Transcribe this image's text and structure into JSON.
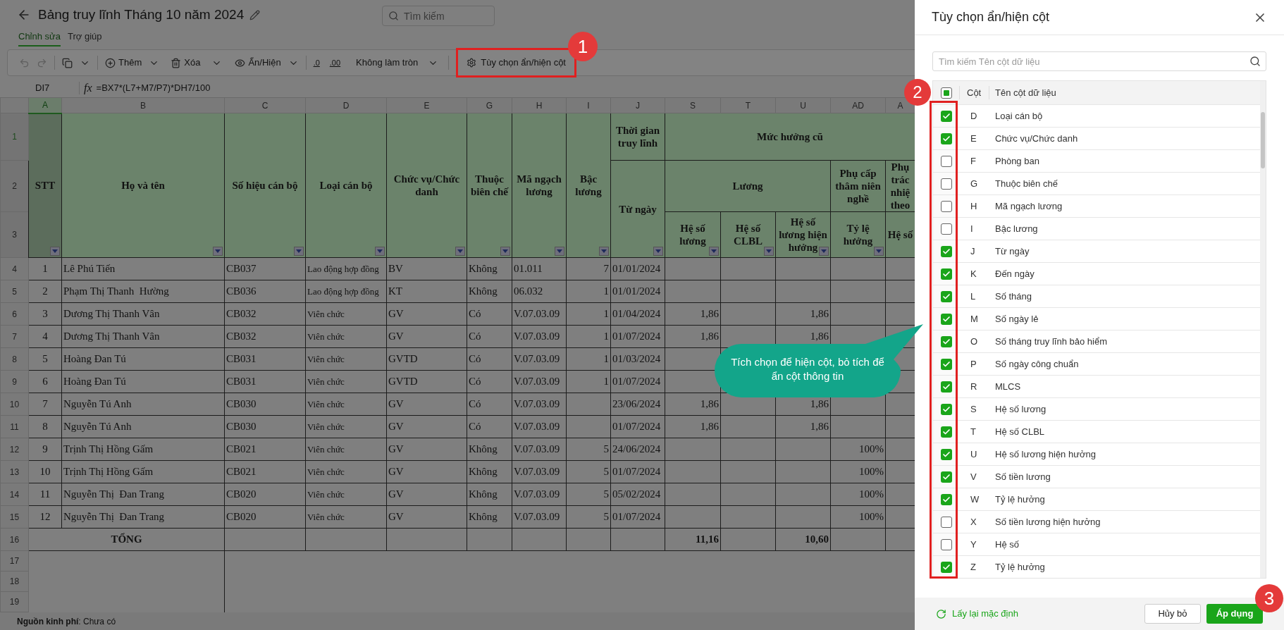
{
  "header": {
    "title": "Bảng truy lĩnh Tháng 10 năm 2024",
    "search": {
      "placeholder": "Tìm kiếm"
    }
  },
  "tabs": [
    {
      "label": "Chỉnh sửa",
      "selected": true
    },
    {
      "label": "Trợ giúp",
      "selected": false
    }
  ],
  "toolbar": {
    "undo": {
      "disabled": true
    },
    "redo": {
      "disabled": true
    },
    "add": "Thêm",
    "delete": "Xóa",
    "show_hide": "Ẩn/Hiện",
    "decrease_decimal": ".0",
    "increase_decimal": ".00",
    "rounding": "Không làm tròn",
    "column_options": "Tùy chọn ẩn/hiện cột"
  },
  "formula_bar": {
    "cell": "DI7",
    "fx": "fx",
    "formula": "=BX7*(L7+M7/P7)*DH7/100"
  },
  "sheet": {
    "columns": [
      {
        "letter": "A",
        "selected": true
      },
      {
        "letter": "B",
        "selected": false
      },
      {
        "letter": "C",
        "selected": false
      },
      {
        "letter": "D",
        "selected": false
      },
      {
        "letter": "E",
        "selected": false
      },
      {
        "letter": "G",
        "selected": false
      },
      {
        "letter": "H",
        "selected": false
      },
      {
        "letter": "I",
        "selected": false
      },
      {
        "letter": "J",
        "selected": false
      },
      {
        "letter": "S",
        "selected": false
      },
      {
        "letter": "T",
        "selected": false
      },
      {
        "letter": "U",
        "selected": false
      },
      {
        "letter": "AD",
        "selected": false
      },
      {
        "letter": "A",
        "selected": false
      }
    ],
    "header_row_numbers": [
      "1",
      "2",
      "3"
    ],
    "header_row_1": [
      "STT",
      "Họ và tên",
      "Số hiệu cán bộ",
      "Loại cán bộ",
      "Chức vụ/Chức danh",
      "Thuộc biên chế",
      "Mã ngạch lương",
      "Bậc lương",
      "Thời gian truy lĩnh",
      "Mức hưởng cũ"
    ],
    "header_row_2": [
      "Từ ngày",
      "Lương",
      "Phụ cấp thâm niên nghề",
      "Phụ trác nhiệ theo"
    ],
    "header_row_3": [
      "Hệ số lương",
      "Hệ số CLBL",
      "Hệ số lương hiện hưởng",
      "Tỷ lệ hưởng",
      "Hệ số"
    ],
    "rows": [
      {
        "row": "4",
        "cells": [
          "1",
          "Lê Phú Tiến",
          "CB037",
          "Lao động hợp đồng",
          "BV",
          "Không",
          "01.011",
          "7",
          "01/01/2024",
          null,
          null,
          null,
          null,
          null
        ]
      },
      {
        "row": "5",
        "cells": [
          "2",
          "Phạm Thị Thanh  Hường",
          "CB036",
          "Lao động hợp đồng",
          "KT",
          "Không",
          "06.032",
          "1",
          "01/01/2024",
          null,
          null,
          null,
          null,
          null
        ]
      },
      {
        "row": "6",
        "cells": [
          "3",
          "Dương Thị Thanh Vân",
          "CB032",
          "Viên chức",
          "GV",
          "Có",
          "V.07.03.09",
          "1",
          "01/04/2024",
          "1,86",
          null,
          "1,86",
          null,
          null
        ]
      },
      {
        "row": "7",
        "cells": [
          "4",
          "Dương Thị Thanh Vân",
          "CB032",
          "Viên chức",
          "GV",
          "Có",
          "V.07.03.09",
          "1",
          "01/07/2024",
          "1,86",
          null,
          "1,86",
          null,
          null
        ]
      },
      {
        "row": "8",
        "cells": [
          "5",
          "Hoàng Đan Tú",
          "CB031",
          "Viên chức",
          "GVTD",
          "Có",
          "V.07.03.09",
          "1",
          "01/03/2024",
          null,
          null,
          null,
          null,
          null
        ]
      },
      {
        "row": "9",
        "cells": [
          "6",
          "Hoàng Đan Tú",
          "CB031",
          "Viên chức",
          "GVTD",
          "Có",
          "V.07.03.09",
          "1",
          "01/07/2024",
          null,
          null,
          null,
          null,
          null
        ]
      },
      {
        "row": "10",
        "cells": [
          "7",
          "Nguyễn Tú Anh",
          "CB030",
          "Viên chức",
          "GV",
          "Có",
          "V.07.03.09",
          null,
          "23/06/2024",
          "1,86",
          null,
          "1,86",
          null,
          null
        ]
      },
      {
        "row": "11",
        "cells": [
          "8",
          "Nguyễn Tú Anh",
          "CB030",
          "Viên chức",
          "GV",
          "Có",
          "V.07.03.09",
          null,
          "01/07/2024",
          "1,86",
          null,
          "1,86",
          null,
          null
        ]
      },
      {
        "row": "12",
        "cells": [
          "9",
          "Trịnh Thị Hồng Gấm",
          "CB021",
          "Viên chức",
          "GV",
          "Không",
          "V.07.03.09",
          "5",
          "24/06/2024",
          null,
          null,
          null,
          "100%",
          null
        ]
      },
      {
        "row": "13",
        "cells": [
          "10",
          "Trịnh Thị Hồng Gấm",
          "CB021",
          "Viên chức",
          "GV",
          "Không",
          "V.07.03.09",
          "5",
          "01/07/2024",
          null,
          null,
          null,
          "100%",
          null
        ]
      },
      {
        "row": "14",
        "cells": [
          "11",
          "Nguyễn Thị  Đan Trang",
          "CB020",
          "Viên chức",
          "GV",
          "Không",
          "V.07.03.09",
          "5",
          "05/02/2024",
          null,
          null,
          null,
          "100%",
          null
        ]
      },
      {
        "row": "15",
        "cells": [
          "12",
          "Nguyễn Thị  Đan Trang",
          "CB020",
          "Viên chức",
          "GV",
          "Không",
          "V.07.03.09",
          "5",
          "01/07/2024",
          null,
          null,
          null,
          "100%",
          null
        ]
      }
    ],
    "total": {
      "row": "16",
      "label": "TỔNG",
      "cells": [
        null,
        null,
        null,
        null,
        null,
        null,
        null,
        "11,16",
        null,
        "10,60",
        null,
        null
      ]
    },
    "empty_rows": [
      "17",
      "18",
      "19"
    ]
  },
  "footer": "**Nguồn kinh phí**: Chưa có",
  "callout": "Tích chọn để hiện cột, bỏ tích để ẩn cột thông tin",
  "annotations": [
    "1",
    "2",
    "3"
  ],
  "panel": {
    "title": "Tùy chọn ẩn/hiện cột",
    "search": {
      "placeholder": "Tìm kiếm Tên cột dữ liệu"
    },
    "select_all": {
      "indeterminate": true
    },
    "columns": [
      "Cột",
      "Tên cột dữ liệu"
    ],
    "items": [
      {
        "column": "D",
        "name": "Loại cán bộ",
        "checked": true
      },
      {
        "column": "E",
        "name": "Chức vụ/Chức danh",
        "checked": true
      },
      {
        "column": "F",
        "name": "Phòng ban",
        "checked": false
      },
      {
        "column": "G",
        "name": "Thuộc biên chế",
        "checked": false
      },
      {
        "column": "H",
        "name": "Mã ngạch lương",
        "checked": false
      },
      {
        "column": "I",
        "name": "Bậc lương",
        "checked": false
      },
      {
        "column": "J",
        "name": "Từ ngày",
        "checked": true
      },
      {
        "column": "K",
        "name": "Đến ngày",
        "checked": true
      },
      {
        "column": "L",
        "name": "Số tháng",
        "checked": true
      },
      {
        "column": "M",
        "name": "Số ngày lẻ",
        "checked": true
      },
      {
        "column": "O",
        "name": "Số tháng truy lĩnh bảo hiểm",
        "checked": true
      },
      {
        "column": "P",
        "name": "Số ngày công chuẩn",
        "checked": true
      },
      {
        "column": "R",
        "name": "MLCS",
        "checked": true
      },
      {
        "column": "S",
        "name": "Hệ số lương",
        "checked": true
      },
      {
        "column": "T",
        "name": "Hệ số CLBL",
        "checked": true
      },
      {
        "column": "U",
        "name": "Hệ số lương hiện hưởng",
        "checked": true
      },
      {
        "column": "V",
        "name": "Số tiền lương",
        "checked": true
      },
      {
        "column": "W",
        "name": "Tỷ lệ hưởng",
        "checked": true
      },
      {
        "column": "X",
        "name": "Số tiền lương hiện hưởng",
        "checked": false
      },
      {
        "column": "Y",
        "name": "Hệ số",
        "checked": false
      },
      {
        "column": "Z",
        "name": "Tỷ lệ hưởng",
        "checked": true
      }
    ],
    "reset": "Lấy lại mặc định",
    "cancel": "Hủy bỏ",
    "apply": "Áp dụng"
  }
}
